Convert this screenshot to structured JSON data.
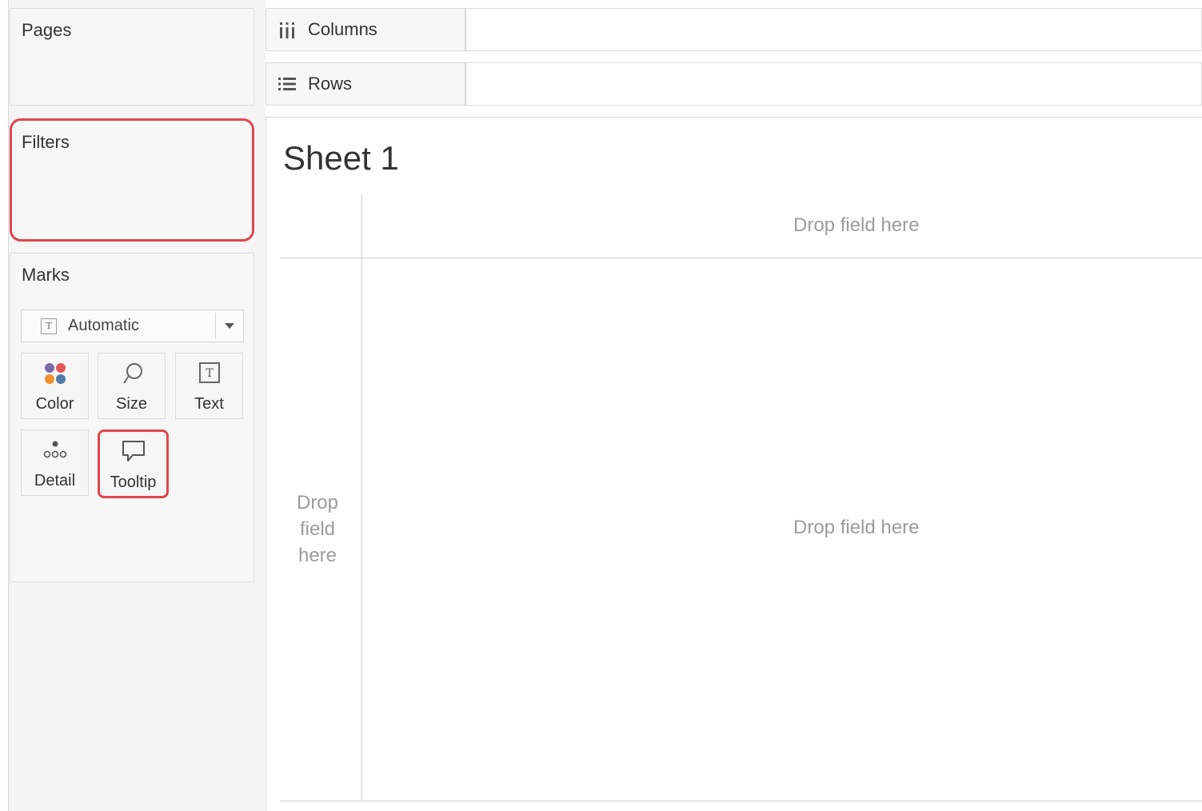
{
  "cards": {
    "pages": {
      "title": "Pages"
    },
    "filters": {
      "title": "Filters"
    },
    "marks": {
      "title": "Marks",
      "mark_type": "Automatic",
      "buttons": {
        "color": "Color",
        "size": "Size",
        "text": "Text",
        "detail": "Detail",
        "tooltip": "Tooltip"
      }
    }
  },
  "shelves": {
    "columns": {
      "label": "Columns"
    },
    "rows": {
      "label": "Rows"
    }
  },
  "view": {
    "sheet_title": "Sheet 1",
    "drop_columns": "Drop field here",
    "drop_rows_line1": "Drop",
    "drop_rows_line2": "field",
    "drop_rows_line3": "here",
    "drop_center": "Drop field here"
  },
  "colors": {
    "highlight": "#e0474c",
    "dot_purple": "#7b6aa8",
    "dot_red": "#e15759",
    "dot_orange": "#f28e2b",
    "dot_blue": "#4e79a7"
  },
  "icons": {
    "columns": "columns-icon",
    "rows": "rows-icon",
    "mark_type": "text-mark-icon",
    "color": "color-dots-icon",
    "size": "size-lasso-icon",
    "text": "text-box-icon",
    "detail": "detail-dots-icon",
    "tooltip": "tooltip-bubble-icon",
    "dropdown": "chevron-down-icon"
  }
}
